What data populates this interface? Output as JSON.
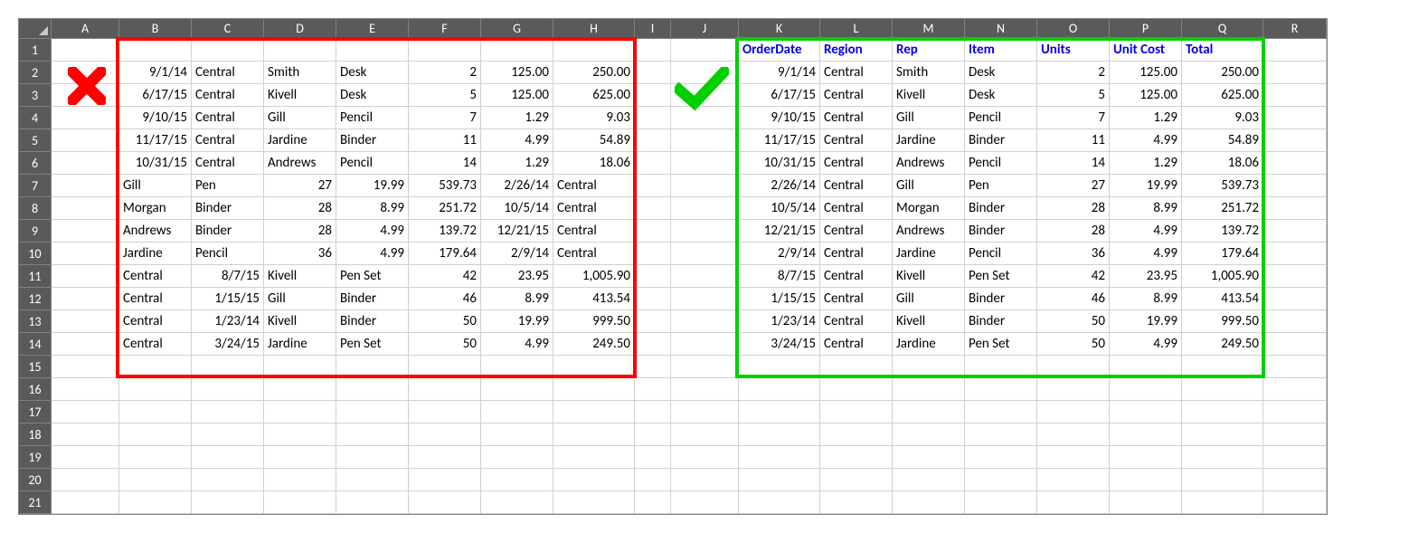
{
  "columns": [
    "A",
    "B",
    "C",
    "D",
    "E",
    "F",
    "G",
    "H",
    "I",
    "J",
    "K",
    "L",
    "M",
    "N",
    "O",
    "P",
    "Q",
    "R"
  ],
  "row_numbers": [
    "1",
    "2",
    "3",
    "4",
    "5",
    "6",
    "7",
    "8",
    "9",
    "10",
    "11",
    "12",
    "13",
    "14",
    "15",
    "16",
    "17",
    "18",
    "19",
    "20",
    "21"
  ],
  "headers_right": {
    "K": "OrderDate",
    "L": "Region",
    "M": "Rep",
    "N": "Item",
    "O": "Units",
    "P": "Unit Cost",
    "Q": "Total"
  },
  "left_rows": [
    {
      "B": "9/1/14",
      "C": "Central",
      "D": "Smith",
      "E": "Desk",
      "F": "2",
      "G": "125.00",
      "H": "250.00"
    },
    {
      "B": "6/17/15",
      "C": "Central",
      "D": "Kivell",
      "E": "Desk",
      "F": "5",
      "G": "125.00",
      "H": "625.00"
    },
    {
      "B": "9/10/15",
      "C": "Central",
      "D": "Gill",
      "E": "Pencil",
      "F": "7",
      "G": "1.29",
      "H": "9.03"
    },
    {
      "B": "11/17/15",
      "C": "Central",
      "D": "Jardine",
      "E": "Binder",
      "F": "11",
      "G": "4.99",
      "H": "54.89"
    },
    {
      "B": "10/31/15",
      "C": "Central",
      "D": "Andrews",
      "E": "Pencil",
      "F": "14",
      "G": "1.29",
      "H": "18.06"
    },
    {
      "B": "Gill",
      "C": "Pen",
      "D": "27",
      "E": "19.99",
      "F": "539.73",
      "G": "2/26/14",
      "H": "Central"
    },
    {
      "B": "Morgan",
      "C": "Binder",
      "D": "28",
      "E": "8.99",
      "F": "251.72",
      "G": "10/5/14",
      "H": "Central"
    },
    {
      "B": "Andrews",
      "C": "Binder",
      "D": "28",
      "E": "4.99",
      "F": "139.72",
      "G": "12/21/15",
      "H": "Central"
    },
    {
      "B": "Jardine",
      "C": "Pencil",
      "D": "36",
      "E": "4.99",
      "F": "179.64",
      "G": "2/9/14",
      "H": "Central"
    },
    {
      "B": "Central",
      "C": "8/7/15",
      "D": "Kivell",
      "E": "Pen Set",
      "F": "42",
      "G": "23.95",
      "H": "1,005.90"
    },
    {
      "B": "Central",
      "C": "1/15/15",
      "D": "Gill",
      "E": "Binder",
      "F": "46",
      "G": "8.99",
      "H": "413.54"
    },
    {
      "B": "Central",
      "C": "1/23/14",
      "D": "Kivell",
      "E": "Binder",
      "F": "50",
      "G": "19.99",
      "H": "999.50"
    },
    {
      "B": "Central",
      "C": "3/24/15",
      "D": "Jardine",
      "E": "Pen Set",
      "F": "50",
      "G": "4.99",
      "H": "249.50"
    }
  ],
  "left_align": [
    {
      "B": "r",
      "C": "l",
      "D": "l",
      "E": "l",
      "F": "r",
      "G": "r",
      "H": "r"
    },
    {
      "B": "r",
      "C": "l",
      "D": "l",
      "E": "l",
      "F": "r",
      "G": "r",
      "H": "r"
    },
    {
      "B": "r",
      "C": "l",
      "D": "l",
      "E": "l",
      "F": "r",
      "G": "r",
      "H": "r"
    },
    {
      "B": "r",
      "C": "l",
      "D": "l",
      "E": "l",
      "F": "r",
      "G": "r",
      "H": "r"
    },
    {
      "B": "r",
      "C": "l",
      "D": "l",
      "E": "l",
      "F": "r",
      "G": "r",
      "H": "r"
    },
    {
      "B": "l",
      "C": "l",
      "D": "r",
      "E": "r",
      "F": "r",
      "G": "r",
      "H": "l"
    },
    {
      "B": "l",
      "C": "l",
      "D": "r",
      "E": "r",
      "F": "r",
      "G": "r",
      "H": "l"
    },
    {
      "B": "l",
      "C": "l",
      "D": "r",
      "E": "r",
      "F": "r",
      "G": "r",
      "H": "l"
    },
    {
      "B": "l",
      "C": "l",
      "D": "r",
      "E": "r",
      "F": "r",
      "G": "r",
      "H": "l"
    },
    {
      "B": "l",
      "C": "r",
      "D": "l",
      "E": "l",
      "F": "r",
      "G": "r",
      "H": "r"
    },
    {
      "B": "l",
      "C": "r",
      "D": "l",
      "E": "l",
      "F": "r",
      "G": "r",
      "H": "r"
    },
    {
      "B": "l",
      "C": "r",
      "D": "l",
      "E": "l",
      "F": "r",
      "G": "r",
      "H": "r"
    },
    {
      "B": "l",
      "C": "r",
      "D": "l",
      "E": "l",
      "F": "r",
      "G": "r",
      "H": "r"
    }
  ],
  "right_rows": [
    {
      "K": "9/1/14",
      "L": "Central",
      "M": "Smith",
      "N": "Desk",
      "O": "2",
      "P": "125.00",
      "Q": "250.00"
    },
    {
      "K": "6/17/15",
      "L": "Central",
      "M": "Kivell",
      "N": "Desk",
      "O": "5",
      "P": "125.00",
      "Q": "625.00"
    },
    {
      "K": "9/10/15",
      "L": "Central",
      "M": "Gill",
      "N": "Pencil",
      "O": "7",
      "P": "1.29",
      "Q": "9.03"
    },
    {
      "K": "11/17/15",
      "L": "Central",
      "M": "Jardine",
      "N": "Binder",
      "O": "11",
      "P": "4.99",
      "Q": "54.89"
    },
    {
      "K": "10/31/15",
      "L": "Central",
      "M": "Andrews",
      "N": "Pencil",
      "O": "14",
      "P": "1.29",
      "Q": "18.06"
    },
    {
      "K": "2/26/14",
      "L": "Central",
      "M": "Gill",
      "N": "Pen",
      "O": "27",
      "P": "19.99",
      "Q": "539.73"
    },
    {
      "K": "10/5/14",
      "L": "Central",
      "M": "Morgan",
      "N": "Binder",
      "O": "28",
      "P": "8.99",
      "Q": "251.72"
    },
    {
      "K": "12/21/15",
      "L": "Central",
      "M": "Andrews",
      "N": "Binder",
      "O": "28",
      "P": "4.99",
      "Q": "139.72"
    },
    {
      "K": "2/9/14",
      "L": "Central",
      "M": "Jardine",
      "N": "Pencil",
      "O": "36",
      "P": "4.99",
      "Q": "179.64"
    },
    {
      "K": "8/7/15",
      "L": "Central",
      "M": "Kivell",
      "N": "Pen Set",
      "O": "42",
      "P": "23.95",
      "Q": "1,005.90"
    },
    {
      "K": "1/15/15",
      "L": "Central",
      "M": "Gill",
      "N": "Binder",
      "O": "46",
      "P": "8.99",
      "Q": "413.54"
    },
    {
      "K": "1/23/14",
      "L": "Central",
      "M": "Kivell",
      "N": "Binder",
      "O": "50",
      "P": "19.99",
      "Q": "999.50"
    },
    {
      "K": "3/24/15",
      "L": "Central",
      "M": "Jardine",
      "N": "Pen Set",
      "O": "50",
      "P": "4.99",
      "Q": "249.50"
    }
  ],
  "marks": {
    "cross_color": "#ff0000",
    "check_color": "#00d000"
  }
}
